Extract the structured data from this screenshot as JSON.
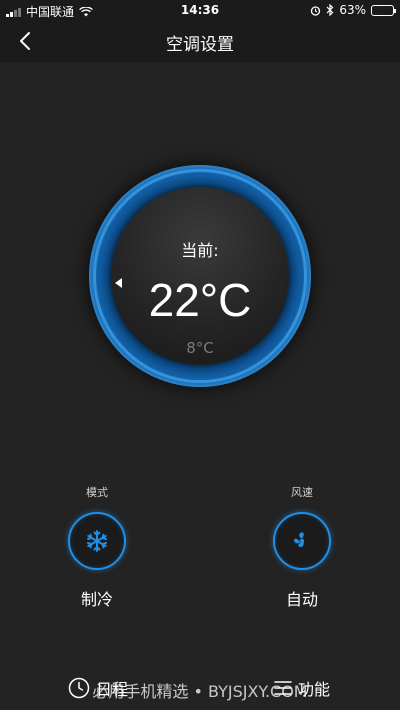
{
  "status_bar": {
    "carrier": "中国联通",
    "time": "14:36",
    "battery": "63%",
    "battery_level": 0.63
  },
  "nav": {
    "title": "空调设置"
  },
  "dial": {
    "label": "当前:",
    "current_temp": "22°C",
    "set_temp": "8°C"
  },
  "controls": {
    "mode": {
      "title": "模式",
      "value": "制冷",
      "icon": "snowflake-icon"
    },
    "fan": {
      "title": "风速",
      "value": "自动",
      "icon": "fan-icon"
    }
  },
  "bottom": {
    "schedule_label": "日程",
    "functions_label": "功能",
    "watermark": "必用手机精选 • BYJSJXY.COM"
  },
  "colors": {
    "accent": "#1f8fe6",
    "background": "#232323",
    "bar": "#1b1b1b"
  }
}
